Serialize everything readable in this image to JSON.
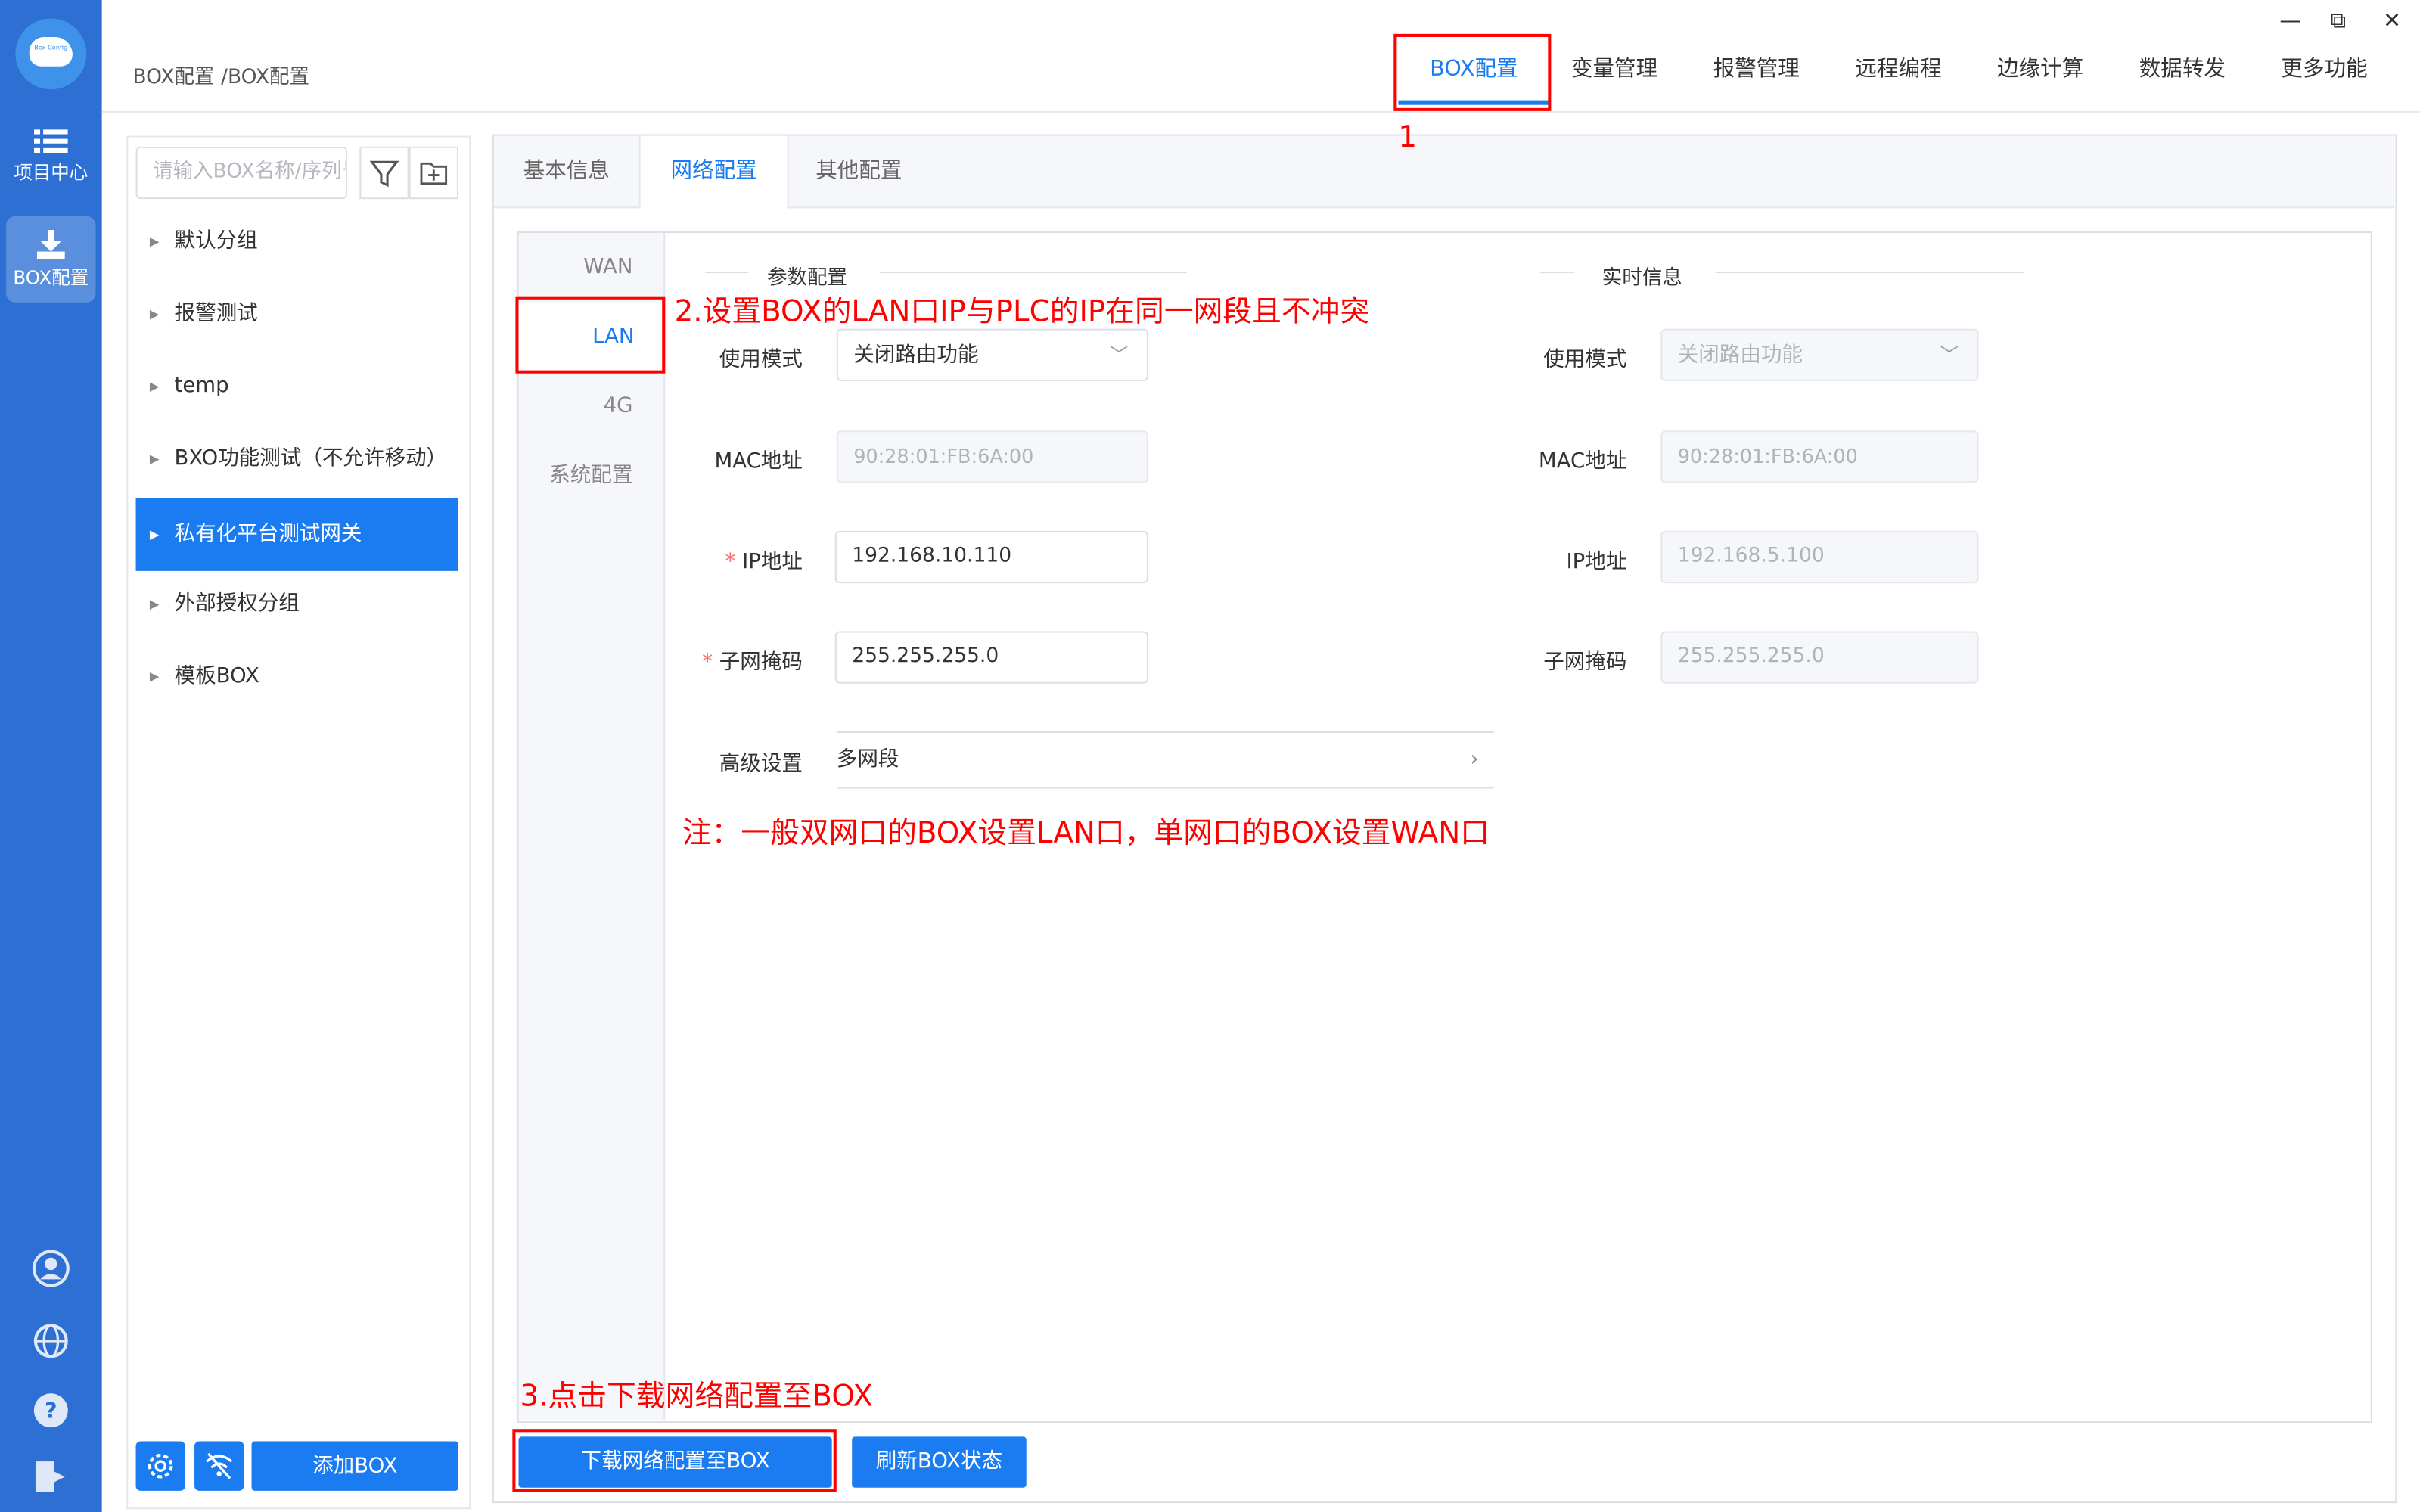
{
  "nav": {
    "logo_text": "Box Config",
    "items": [
      {
        "label": "项目中心",
        "icon": "list-icon"
      },
      {
        "label": "BOX配置",
        "icon": "download-icon"
      }
    ],
    "bottom_icons": [
      "user-icon",
      "globe-icon",
      "help-icon",
      "logout-icon"
    ]
  },
  "breadcrumb": "BOX配置 /BOX配置",
  "top_tabs": [
    "BOX配置",
    "变量管理",
    "报警管理",
    "远程编程",
    "边缘计算",
    "数据转发",
    "更多功能"
  ],
  "window_controls": {
    "minimize": "—",
    "restore": "⧉",
    "close": "✕"
  },
  "sidebar": {
    "search_placeholder": "请输入BOX名称/序列号",
    "groups": [
      "默认分组",
      "报警测试",
      "temp",
      "BXO功能测试（不允许移动）",
      "私有化平台测试网关",
      "外部授权分组",
      "模板BOX"
    ],
    "selected_index": 4,
    "add_button": "添加BOX"
  },
  "main_tabs": [
    "基本信息",
    "网络配置",
    "其他配置"
  ],
  "vertical_tabs": [
    "WAN",
    "LAN",
    "4G",
    "系统配置"
  ],
  "params": {
    "title": "参数配置",
    "mode_label": "使用模式",
    "mode_value": "关闭路由功能",
    "mac_label": "MAC地址",
    "mac_value": "90:28:01:FB:6A:00",
    "ip_label": "IP地址",
    "ip_value": "192.168.10.110",
    "mask_label": "子网掩码",
    "mask_value": "255.255.255.0",
    "advanced_label": "高级设置",
    "advanced_value": "多网段",
    "required_mark": "*"
  },
  "realtime": {
    "title": "实时信息",
    "mode_label": "使用模式",
    "mode_value": "关闭路由功能",
    "mac_label": "MAC地址",
    "mac_value": "90:28:01:FB:6A:00",
    "ip_label": "IP地址",
    "ip_value": "192.168.5.100",
    "mask_label": "子网掩码",
    "mask_value": "255.255.255.0"
  },
  "buttons": {
    "download": "下载网络配置至BOX",
    "refresh": "刷新BOX状态"
  },
  "annotations": {
    "step1": "1",
    "step2": "2.设置BOX的LAN口IP与PLC的IP在同一网段且不冲突",
    "note": "注：一般双网口的BOX设置LAN口，单网口的BOX设置WAN口",
    "step3": "3.点击下载网络配置至BOX"
  },
  "colors": {
    "accent": "#1a7cf0",
    "nav_bg": "#2e6fd4",
    "annotation": "#ff0000"
  }
}
